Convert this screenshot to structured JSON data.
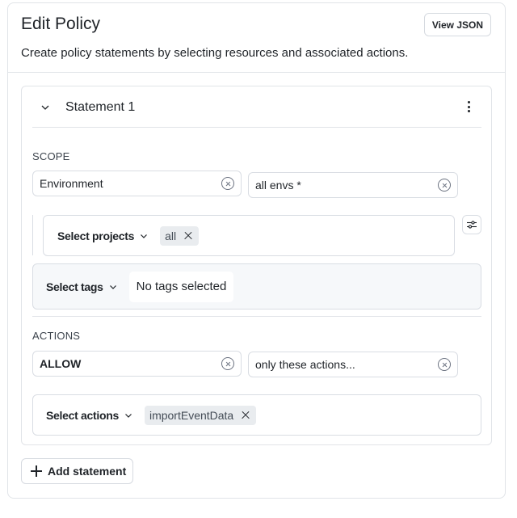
{
  "header": {
    "title": "Edit Policy",
    "subtitle": "Create policy statements by selecting resources and associated actions.",
    "view_json_label": "View JSON"
  },
  "statement": {
    "title": "Statement 1",
    "collapse_icon": "chevron-down-icon",
    "menu_icon": "more-vertical-icon",
    "scope": {
      "label": "SCOPE",
      "resource_type": "Environment",
      "resource_value": "all envs *",
      "projects": {
        "label": "Select projects",
        "selected": [
          "all"
        ]
      },
      "filter_icon": "sliders-icon",
      "tags": {
        "label": "Select tags",
        "empty_text": "No tags selected"
      }
    },
    "actions": {
      "label": "ACTIONS",
      "effect": "ALLOW",
      "mode": "only these actions...",
      "select": {
        "label": "Select actions",
        "selected": [
          "importEventData"
        ]
      }
    }
  },
  "footer": {
    "add_statement_label": "Add statement",
    "add_icon": "plus-icon"
  }
}
